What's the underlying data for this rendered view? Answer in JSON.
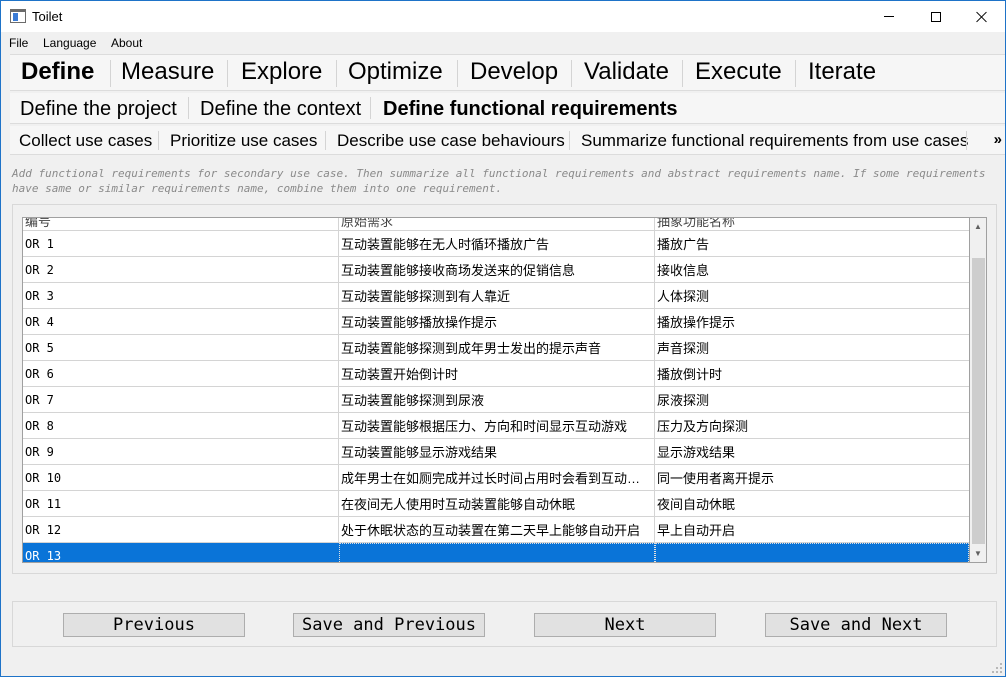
{
  "window": {
    "title": "Toilet",
    "icon": "app-window-icon",
    "controls": {
      "minimize_icon": "minimize-icon",
      "maximize_icon": "maximize-icon",
      "close_icon": "close-icon"
    }
  },
  "menu": {
    "file": "File",
    "language": "Language",
    "about": "About"
  },
  "phase_tabs": {
    "define": "Define",
    "measure": "Measure",
    "explore": "Explore",
    "optimize": "Optimize",
    "develop": "Develop",
    "validate": "Validate",
    "execute": "Execute",
    "iterate": "Iterate",
    "active": "Define"
  },
  "step_tabs": {
    "project": "Define the project",
    "context": "Define the context",
    "functional": "Define functional requirements",
    "active": "Define functional requirements"
  },
  "sub_tabs": {
    "collect": "Collect use cases",
    "prioritize": "Prioritize use cases",
    "describe": "Describe use case behaviours",
    "summarize": "Summarize functional requirements from use cases",
    "more_icon": "double-chevron-right-icon"
  },
  "instruction": "Add functional requirements for secondary use case. Then summarize all functional requirements and abstract requirements name. If some requirements have same or similar requirements name, combine them into one requirement.",
  "table": {
    "partial_header": [
      "编号",
      "原始需求",
      "抽象功能名称"
    ],
    "rows": [
      [
        "OR 1",
        "互动装置能够在无人时循环播放广告",
        "播放广告"
      ],
      [
        "OR 2",
        "互动装置能够接收商场发送来的促销信息",
        "接收信息"
      ],
      [
        "OR 3",
        "互动装置能够探测到有人靠近",
        "人体探测"
      ],
      [
        "OR 4",
        "互动装置能够播放操作提示",
        "播放操作提示"
      ],
      [
        "OR 5",
        "互动装置能够探测到成年男士发出的提示声音",
        "声音探测"
      ],
      [
        "OR 6",
        "互动装置开始倒计时",
        "播放倒计时"
      ],
      [
        "OR 7",
        "互动装置能够探测到尿液",
        "尿液探测"
      ],
      [
        "OR 8",
        "互动装置能够根据压力、方向和时间显示互动游戏",
        "压力及方向探测"
      ],
      [
        "OR 9",
        "互动装置能够显示游戏结果",
        "显示游戏结果"
      ],
      [
        "OR 10",
        "成年男士在如厕完成并过长时间占用时会看到互动…",
        "同一使用者离开提示"
      ],
      [
        "OR 11",
        "在夜间无人使用时互动装置能够自动休眠",
        "夜间自动休眠"
      ],
      [
        "OR 12",
        "处于休眠状态的互动装置在第二天早上能够自动开启",
        "早上自动开启"
      ],
      [
        "OR 13",
        "",
        ""
      ]
    ],
    "selected_row": "OR 13",
    "scroll_up_icon": "scroll-up-arrow-icon",
    "scroll_down_icon": "scroll-down-arrow-icon"
  },
  "nav": {
    "previous": "Previous",
    "save_previous": "Save and Previous",
    "next": "Next",
    "save_next": "Save and Next"
  },
  "colors": {
    "selection": "#0a74d8",
    "window_border": "#1e73c8",
    "instruction_text": "#8a8a8a"
  }
}
